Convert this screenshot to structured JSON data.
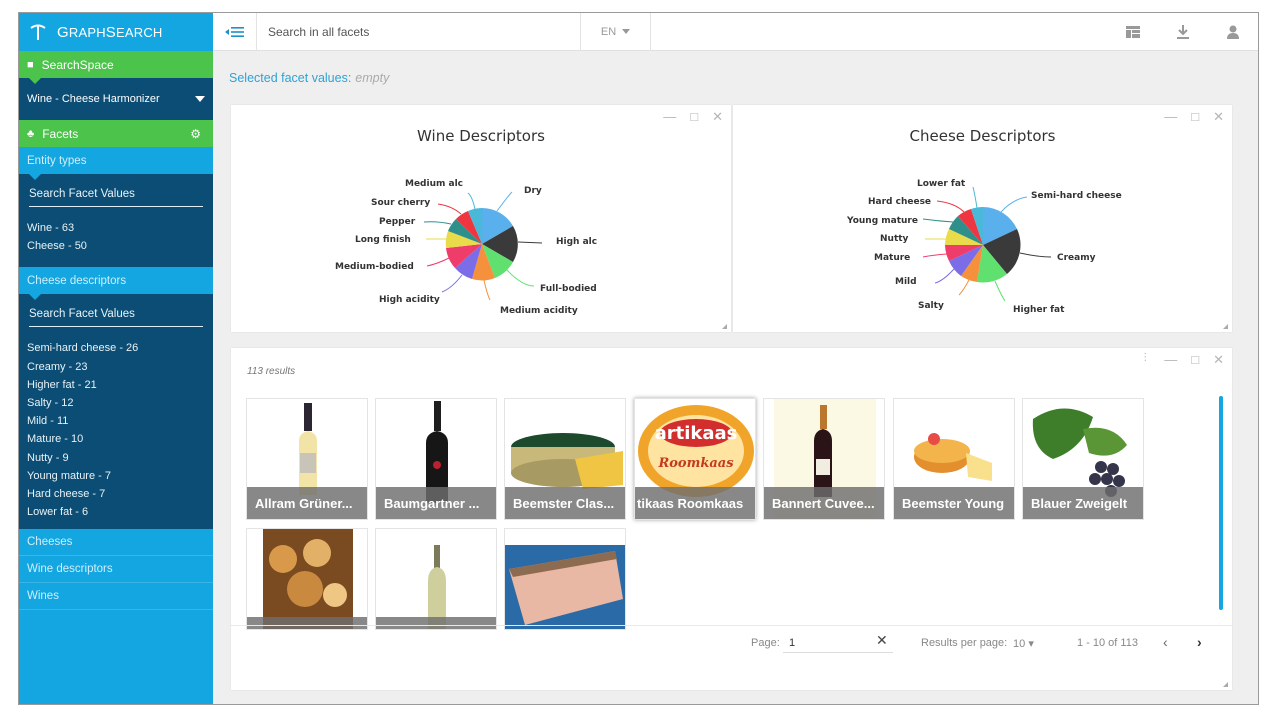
{
  "brand": {
    "name_first": "G",
    "name_rest": "RAPH",
    "name_second": "S",
    "name_second_rest": "EARCH"
  },
  "sidebar": {
    "search_space_label": "SearchSpace",
    "space_select": "Wine - Cheese Harmonizer",
    "facets_label": "Facets",
    "entity_types": {
      "heading": "Entity types",
      "search_label": "Search Facet Values",
      "items": [
        "Wine - 63",
        "Cheese - 50"
      ]
    },
    "cheese_descriptors": {
      "heading": "Cheese descriptors",
      "search_label": "Search Facet Values",
      "items": [
        "Semi-hard cheese - 26",
        "Creamy - 23",
        "Higher fat - 21",
        "Salty - 12",
        "Mild - 11",
        "Mature - 10",
        "Nutty - 9",
        "Young mature - 7",
        "Hard cheese - 7",
        "Lower fat - 6"
      ]
    },
    "other_items": [
      "Cheeses",
      "Wine descriptors",
      "Wines"
    ]
  },
  "topbar": {
    "search_placeholder": "Search in all facets",
    "lang": "EN"
  },
  "selected": {
    "label": "Selected facet values:",
    "value": "empty"
  },
  "charts": {
    "wine": {
      "title": "Wine Descriptors",
      "labels": [
        "Dry",
        "High alc",
        "Full-bodied",
        "Medium acidity",
        "High acidity",
        "Medium-bodied",
        "Long finish",
        "Pepper",
        "Sour cherry",
        "Medium alc"
      ]
    },
    "cheese": {
      "title": "Cheese Descriptors",
      "labels": [
        "Semi-hard cheese",
        "Creamy",
        "Higher fat",
        "Salty",
        "Mild",
        "Mature",
        "Nutty",
        "Young mature",
        "Hard cheese",
        "Lower fat"
      ]
    }
  },
  "results": {
    "count": "113 results",
    "tiles": [
      "Allram Grüner...",
      "Baumgartner ...",
      "Beemster Clas...",
      "tikaas Roomkaas",
      "Bannert Cuvee...",
      "Beemster Young",
      "Blauer Zweigelt",
      "",
      "",
      ""
    ],
    "artikaas_logo": "artikaas",
    "artikaas_sub": "Roomkaas"
  },
  "pager": {
    "page_label": "Page:",
    "page_value": "1",
    "per_page_label": "Results per page:",
    "per_page_value": "10",
    "range": "1 - 10 of 113"
  }
}
